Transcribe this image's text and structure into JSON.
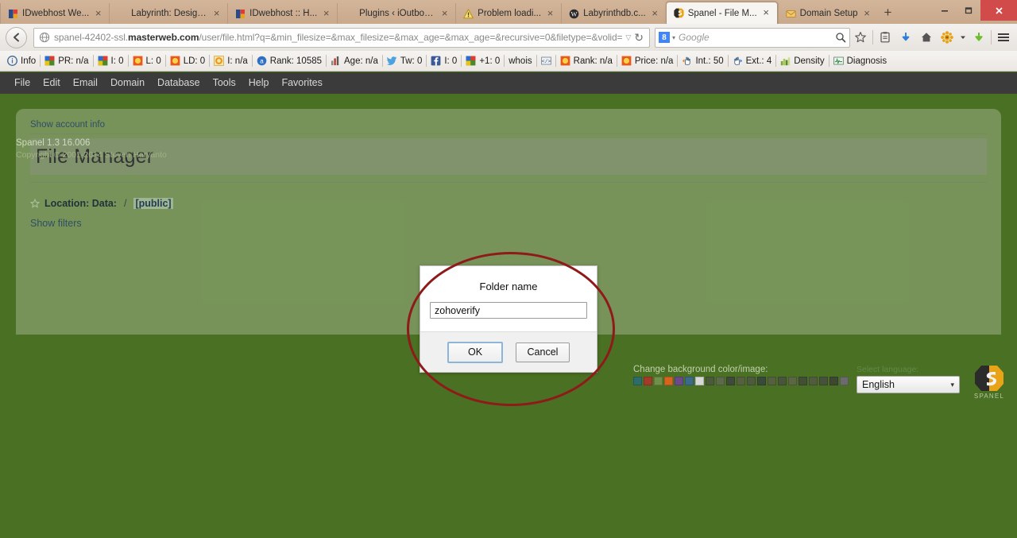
{
  "browser": {
    "tabs": [
      {
        "label": "IDwebhost We...",
        "icon": "idwebhost-icon",
        "active": false
      },
      {
        "label": "Labyrinth: Design a...",
        "icon": "blank-icon",
        "active": false
      },
      {
        "label": "IDwebhost :: H...",
        "icon": "idwebhost-icon",
        "active": false
      },
      {
        "label": "Plugins ‹ iOutboun...",
        "icon": "blank-icon",
        "active": false
      },
      {
        "label": "Problem loadi...",
        "icon": "warning-icon",
        "active": false
      },
      {
        "label": "Labyrinthdb.c...",
        "icon": "wordpress-icon",
        "active": false
      },
      {
        "label": "Spanel - File M...",
        "icon": "spanel-icon",
        "active": true
      },
      {
        "label": "Domain Setup",
        "icon": "mail-icon",
        "active": false
      }
    ],
    "new_tab_label": "+",
    "close_label": "×",
    "window_controls": {
      "minimize": "–",
      "maximize": "❐",
      "close": "×"
    },
    "url": {
      "host_prefix": "spanel-42402-ssl.",
      "host_bold": "masterweb.com",
      "path": "/user/file.html?q=&min_filesize=&max_filesize=&max_age=&max_age=&recursive=0&filetype=&volid=c",
      "caret": "▽",
      "reload": "↻"
    },
    "search": {
      "engine": "8",
      "placeholder": "Google",
      "caret": "▾"
    },
    "nav_icons": [
      "bookmark-star-icon",
      "reading-list-icon",
      "download-arrow-icon",
      "home-icon",
      "addon-gear-icon",
      "dropdown-caret-icon",
      "green-download-icon",
      "hamburger-menu-icon"
    ]
  },
  "seo_toolbar": {
    "items": [
      {
        "label": "Info",
        "icon": "info-icon"
      },
      {
        "label": "PR: n/a",
        "icon": "pagerank-icon"
      },
      {
        "label": "I: 0",
        "icon": "pagerank-icon"
      },
      {
        "label": "L: 0",
        "icon": "sun-icon"
      },
      {
        "label": "LD: 0",
        "icon": "sun-icon"
      },
      {
        "label": "I: n/a",
        "icon": "ring-icon"
      },
      {
        "label": "Rank: 10585",
        "icon": "alexa-icon"
      },
      {
        "label": "Age: n/a",
        "icon": "bars-icon"
      },
      {
        "label": "Tw: 0",
        "icon": "twitter-icon"
      },
      {
        "label": "I: 0",
        "icon": "facebook-icon"
      },
      {
        "label": "+1: 0",
        "icon": "googleplus-icon"
      },
      {
        "label": "whois",
        "icon": "none"
      },
      {
        "label": "",
        "icon": "code-icon"
      },
      {
        "label": "Rank: n/a",
        "icon": "sun-icon"
      },
      {
        "label": "Price: n/a",
        "icon": "sun-icon"
      },
      {
        "label": "Int.: 50",
        "icon": "hand-left-icon"
      },
      {
        "label": "Ext.: 4",
        "icon": "hand-right-icon"
      },
      {
        "label": "Density",
        "icon": "density-icon"
      },
      {
        "label": "Diagnosis",
        "icon": "diagnosis-icon"
      }
    ]
  },
  "app": {
    "menu": [
      "File",
      "Edit",
      "Email",
      "Domain",
      "Database",
      "Tools",
      "Help",
      "Favorites"
    ],
    "account_info_link": "Show account info",
    "page_title": "File Manager",
    "location": {
      "label": "Location: Data:",
      "separator": "/",
      "current": "[public]"
    },
    "show_filters_link": "Show filters",
    "footer": {
      "version": "Spanel 1.3 16.006",
      "copyright": "Copyright © 2001-2014 Steven Haryanto"
    },
    "background_picker": {
      "title": "Change background color/image:",
      "swatches": [
        "#2e6b6b",
        "#a33a2a",
        "#6f8f4a",
        "#d4641e",
        "#6a4a8a",
        "#3b6a8a",
        "#d8d8d8",
        "#4a5a3a",
        "#5a6a4a",
        "#3f4a38",
        "#55603f",
        "#4d5a3e",
        "#3a4a3a",
        "#54603e",
        "#48553a",
        "#5c6644",
        "#414f36",
        "#505c3d",
        "#46523a",
        "#3d4833",
        "#6b6b6b"
      ]
    },
    "language": {
      "label": "Select language:",
      "selected": "English",
      "caret": "▾"
    },
    "logo": {
      "text": "SPANEL"
    }
  },
  "dialog": {
    "label": "Folder name",
    "input_value": "zohoverify",
    "input_placeholder": "",
    "ok_label": "OK",
    "cancel_label": "Cancel"
  },
  "annotation": {
    "shape": "ellipse",
    "color": "#8e1a1a"
  }
}
